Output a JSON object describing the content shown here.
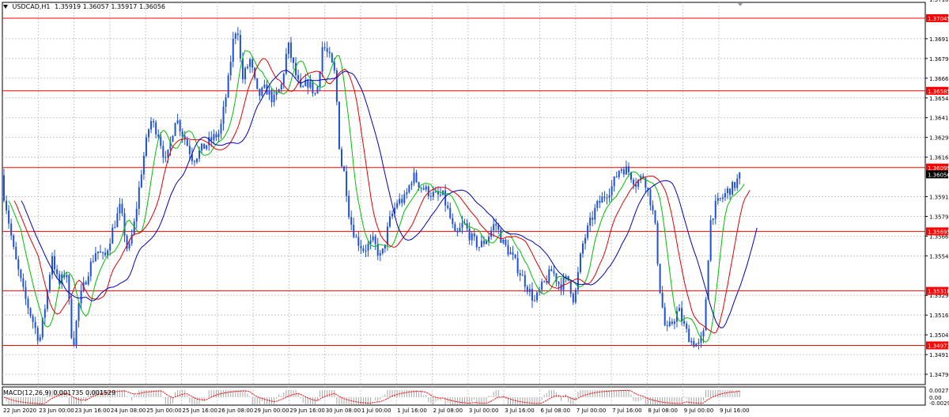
{
  "header": {
    "symbol_label": "USDCAD,H1",
    "ohlc": "1.35919 1.36057 1.35917 1.36056",
    "menu_icon": "triangle-down-icon"
  },
  "macd_panel": {
    "label": "MACD(12,26,9) 0.001735 0.001529",
    "tick_labels": [
      "0.002736",
      "0.00",
      "-0.0029"
    ]
  },
  "chart_data": {
    "type": "candlestick",
    "symbol": "USDCAD",
    "timeframe": "H1",
    "ylim": [
      1.34725,
      1.37145
    ],
    "y_tick_labels": [
      "1.37165",
      "1.36915",
      "1.36790",
      "1.36665",
      "1.36540",
      "1.36415",
      "1.36290",
      "1.36165",
      "1.35915",
      "1.35790",
      "1.35665",
      "1.35540",
      "1.35290",
      "1.35165",
      "1.35040",
      "1.34915",
      "1.34790"
    ],
    "x_tick_labels": [
      "22 Jun 2020",
      "23 Jun 00:00",
      "23 Jun 16:00",
      "24 Jun 08:00",
      "25 Jun 00:00",
      "25 Jun 16:00",
      "26 Jun 08:00",
      "29 Jun 00:00",
      "29 Jun 16:00",
      "30 Jun 08:00",
      "1 Jul 00:00",
      "1 Jul 16:00",
      "2 Jul 08:00",
      "3 Jul 00:00",
      "3 Jul 16:00",
      "6 Jul 08:00",
      "7 Jul 00:00",
      "7 Jul 16:00",
      "8 Jul 08:00",
      "9 Jul 00:00",
      "9 Jul 16:00"
    ],
    "horizontal_levels": [
      "1.37045",
      "1.36585",
      "1.36099",
      "1.35695",
      "1.35318",
      "1.34973"
    ],
    "current_price": "1.36056",
    "price_path": [
      [
        0,
        1.3605
      ],
      [
        8,
        1.3585
      ],
      [
        18,
        1.3555
      ],
      [
        30,
        1.353
      ],
      [
        40,
        1.3515
      ],
      [
        50,
        1.35
      ],
      [
        58,
        1.3525
      ],
      [
        66,
        1.3555
      ],
      [
        74,
        1.3535
      ],
      [
        84,
        1.3545
      ],
      [
        92,
        1.3495
      ],
      [
        100,
        1.3525
      ],
      [
        112,
        1.3545
      ],
      [
        122,
        1.3558
      ],
      [
        132,
        1.3552
      ],
      [
        142,
        1.357
      ],
      [
        152,
        1.3585
      ],
      [
        162,
        1.3555
      ],
      [
        170,
        1.3575
      ],
      [
        180,
        1.3612
      ],
      [
        190,
        1.364
      ],
      [
        200,
        1.3632
      ],
      [
        210,
        1.3612
      ],
      [
        222,
        1.3642
      ],
      [
        234,
        1.3628
      ],
      [
        244,
        1.3615
      ],
      [
        256,
        1.3622
      ],
      [
        268,
        1.3628
      ],
      [
        278,
        1.3632
      ],
      [
        288,
        1.3662
      ],
      [
        294,
        1.3688
      ],
      [
        300,
        1.3702
      ],
      [
        306,
        1.3665
      ],
      [
        316,
        1.3678
      ],
      [
        326,
        1.3655
      ],
      [
        336,
        1.366
      ],
      [
        346,
        1.3652
      ],
      [
        356,
        1.3662
      ],
      [
        364,
        1.3688
      ],
      [
        372,
        1.3672
      ],
      [
        380,
        1.3658
      ],
      [
        390,
        1.3664
      ],
      [
        400,
        1.3655
      ],
      [
        408,
        1.3688
      ],
      [
        416,
        1.368
      ],
      [
        424,
        1.3668
      ],
      [
        430,
        1.3615
      ],
      [
        436,
        1.3605
      ],
      [
        442,
        1.3578
      ],
      [
        450,
        1.3565
      ],
      [
        460,
        1.3558
      ],
      [
        472,
        1.3563
      ],
      [
        482,
        1.3552
      ],
      [
        492,
        1.3575
      ],
      [
        502,
        1.3588
      ],
      [
        512,
        1.359
      ],
      [
        522,
        1.3605
      ],
      [
        532,
        1.3598
      ],
      [
        540,
        1.3595
      ],
      [
        550,
        1.3592
      ],
      [
        560,
        1.3592
      ],
      [
        568,
        1.358
      ],
      [
        576,
        1.3565
      ],
      [
        586,
        1.3575
      ],
      [
        596,
        1.3565
      ],
      [
        606,
        1.356
      ],
      [
        616,
        1.3565
      ],
      [
        626,
        1.3575
      ],
      [
        636,
        1.3562
      ],
      [
        646,
        1.3555
      ],
      [
        656,
        1.3545
      ],
      [
        666,
        1.3535
      ],
      [
        676,
        1.3525
      ],
      [
        686,
        1.3535
      ],
      [
        698,
        1.3545
      ],
      [
        708,
        1.3535
      ],
      [
        718,
        1.354
      ],
      [
        726,
        1.3525
      ],
      [
        736,
        1.356
      ],
      [
        744,
        1.3572
      ],
      [
        754,
        1.3585
      ],
      [
        764,
        1.3592
      ],
      [
        774,
        1.3598
      ],
      [
        784,
        1.361
      ],
      [
        794,
        1.3608
      ],
      [
        804,
        1.36
      ],
      [
        814,
        1.3605
      ],
      [
        822,
        1.359
      ],
      [
        828,
        1.3575
      ],
      [
        834,
        1.3535
      ],
      [
        842,
        1.3505
      ],
      [
        850,
        1.3512
      ],
      [
        858,
        1.352
      ],
      [
        866,
        1.3508
      ],
      [
        874,
        1.35
      ],
      [
        884,
        1.3497
      ],
      [
        890,
        1.3505
      ],
      [
        898,
        1.3575
      ],
      [
        904,
        1.3585
      ],
      [
        912,
        1.359
      ],
      [
        920,
        1.3595
      ],
      [
        928,
        1.3598
      ],
      [
        936,
        1.3605
      ]
    ],
    "ma_series": [
      {
        "color": "#00c000",
        "lag": 6
      },
      {
        "color": "#e00000",
        "lag": 13
      },
      {
        "color": "#0000c0",
        "lag": 22
      }
    ]
  },
  "colors": {
    "candle": "#1e50d8",
    "level_line": "#ff0000",
    "grid": "#c8c8c8",
    "current_price_bg": "#000000",
    "level_label_bg": "#ff0000",
    "macd_hist": "#a8a8a8",
    "macd_signal": "#ff0000"
  }
}
